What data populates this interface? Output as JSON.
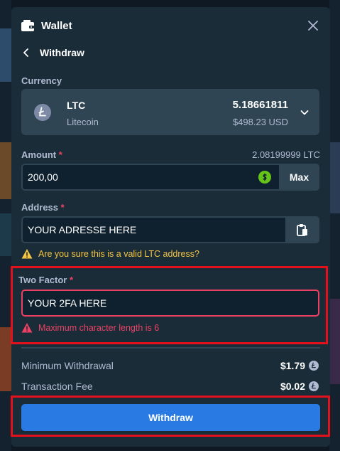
{
  "header": {
    "title": "Wallet",
    "icons": {
      "wallet": "wallet-icon",
      "close": "close-icon"
    }
  },
  "nav": {
    "back_label": "Withdraw"
  },
  "currency": {
    "label": "Currency",
    "symbol": "LTC",
    "name": "Litecoin",
    "amount": "5.18661811",
    "usd": "$498.23 USD"
  },
  "amount": {
    "label": "Amount",
    "required": "*",
    "available": "2.08199999 LTC",
    "value": "200,00",
    "max_label": "Max"
  },
  "address": {
    "label": "Address",
    "required": "*",
    "value": "YOUR ADRESSE HERE",
    "warning": "Are you sure this is a valid LTC address?"
  },
  "two_factor": {
    "label": "Two Factor",
    "required": "*",
    "value": "YOUR 2FA HERE",
    "error": "Maximum character length is 6"
  },
  "fees": [
    {
      "name": "Minimum Withdrawal",
      "value": "$1.79"
    },
    {
      "name": "Transaction Fee",
      "value": "$0.02"
    }
  ],
  "submit_label": "Withdraw",
  "colors": {
    "modal_bg": "#1a2c38",
    "card_bg": "#2f4553",
    "input_bg": "#0f212e",
    "accent_button": "#2a7ae4",
    "warning": "#f5c542",
    "error": "#ed4163",
    "highlight": "#e3111c"
  }
}
